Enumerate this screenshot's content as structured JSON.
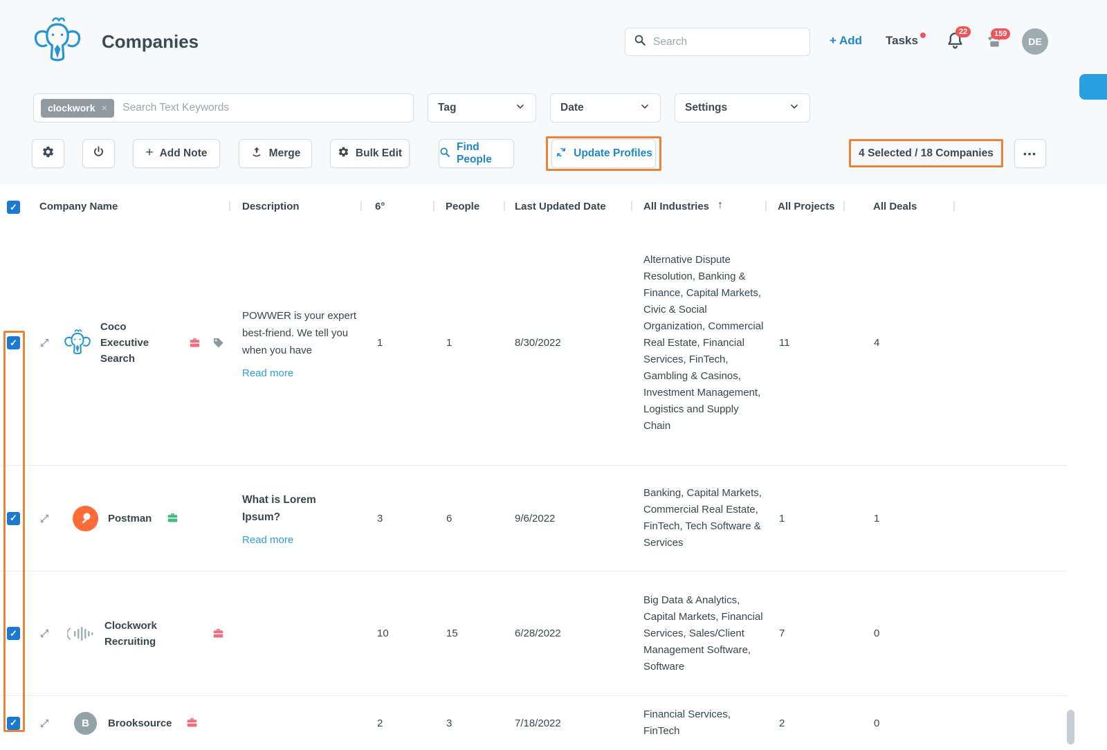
{
  "header": {
    "title": "Companies",
    "search_placeholder": "Search",
    "add_label": "+ Add",
    "tasks_label": "Tasks",
    "bell_badge": "22",
    "call_badge": "159",
    "avatar_initials": "DE"
  },
  "filters": {
    "keyword_chip": "clockwork",
    "chip_remove": "×",
    "search_placeholder": "Search Text Keywords",
    "tag_label": "Tag",
    "date_label": "Date",
    "settings_label": "Settings"
  },
  "toolbar": {
    "add_note_label": "Add Note",
    "merge_label": "Merge",
    "bulk_edit_label": "Bulk Edit",
    "find_people_label": "Find People",
    "update_profiles_label": "Update Profiles",
    "selection_summary": "4 Selected / 18 Companies",
    "more_label": "•••"
  },
  "icons": {
    "plus": "+",
    "sort_ascending": "↑",
    "column_separator": "|"
  },
  "table": {
    "columns": {
      "name": "Company Name",
      "description": "Description",
      "degrees": "6°",
      "people": "People",
      "last_updated": "Last Updated Date",
      "industries": "All Industries",
      "projects": "All Projects",
      "deals": "All Deals"
    },
    "rows": [
      {
        "name": "Coco Executive Search",
        "description": "POWWER is your expert best-friend. We tell you when you have",
        "read_more": "Read more",
        "degrees": "1",
        "people": "1",
        "last_updated": "8/30/2022",
        "industries": "Alternative Dispute Resolution, Banking & Finance, Capital Markets, Civic & Social Organization, Commercial Real Estate, Financial Services, FinTech, Gambling & Casinos, Investment Management, Logistics and Supply Chain",
        "projects": "11",
        "deals": "4"
      },
      {
        "name": "Postman",
        "description": "What is Lorem Ipsum?",
        "read_more": "Read more",
        "degrees": "3",
        "people": "6",
        "last_updated": "9/6/2022",
        "industries": "Banking, Capital Markets, Commercial Real Estate, FinTech, Tech Software & Services",
        "projects": "1",
        "deals": "1"
      },
      {
        "name": "Clockwork Recruiting",
        "degrees": "10",
        "people": "15",
        "last_updated": "6/28/2022",
        "industries": "Big Data & Analytics, Capital Markets, Financial Services, Sales/Client Management Software, Software",
        "projects": "7",
        "deals": "0"
      },
      {
        "name": "Brooksource",
        "monogram": "B",
        "degrees": "2",
        "people": "3",
        "last_updated": "7/18/2022",
        "industries": "Financial Services, FinTech",
        "projects": "2",
        "deals": "0"
      }
    ]
  },
  "colors": {
    "accent_blue": "#1e88c7",
    "annotation_orange": "#e8833a",
    "badge_red": "#f2545b"
  }
}
